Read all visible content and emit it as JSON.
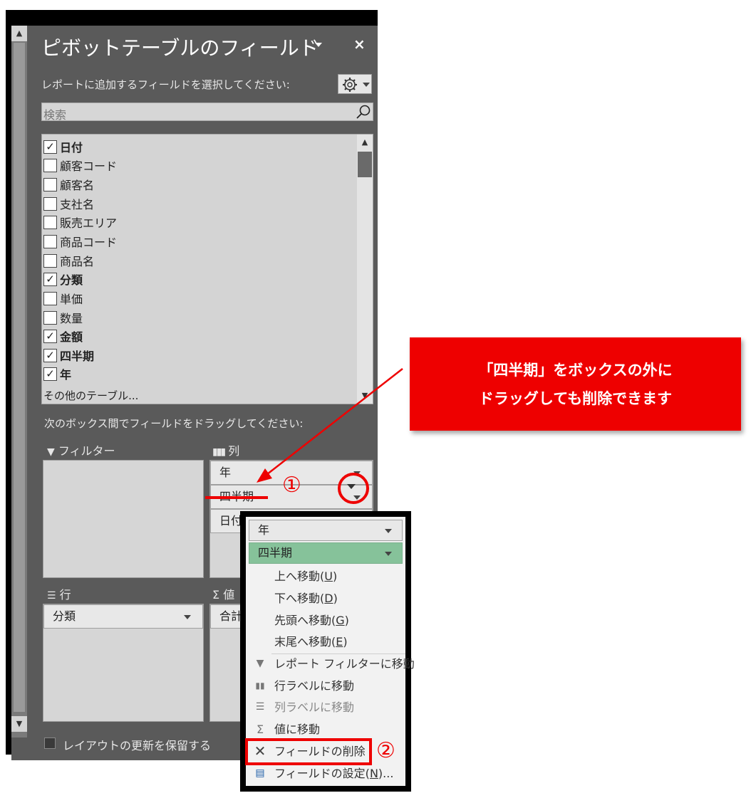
{
  "panel": {
    "title": "ピボットテーブルのフィールド",
    "title_dropdown_icon": "chevron-down-icon",
    "close_label": "×",
    "subtitle": "レポートに追加するフィールドを選択してください:",
    "settings_icon": "gear-icon",
    "search_placeholder": "検索",
    "fields": [
      {
        "label": "日付",
        "checked": true
      },
      {
        "label": "顧客コード",
        "checked": false
      },
      {
        "label": "顧客名",
        "checked": false
      },
      {
        "label": "支社名",
        "checked": false
      },
      {
        "label": "販売エリア",
        "checked": false
      },
      {
        "label": "商品コード",
        "checked": false
      },
      {
        "label": "商品名",
        "checked": false
      },
      {
        "label": "分類",
        "checked": true
      },
      {
        "label": "単価",
        "checked": false
      },
      {
        "label": "数量",
        "checked": false
      },
      {
        "label": "金額",
        "checked": true
      },
      {
        "label": "四半期",
        "checked": true
      },
      {
        "label": "年",
        "checked": true
      }
    ],
    "more_tables": "その他のテーブル...",
    "drag_hint": "次のボックス間でフィールドをドラッグしてください:",
    "areas": {
      "filter_label": "フィルター",
      "columns_label": "列",
      "rows_label": "行",
      "values_label": "値",
      "columns_items": [
        "年",
        "四半期",
        "日付"
      ],
      "rows_items": [
        "分類"
      ],
      "values_items": [
        "合計"
      ]
    },
    "defer_update": "レイアウトの更新を保留する"
  },
  "annotations": {
    "callout_line1": "「四半期」をボックスの外に",
    "callout_line2": "ドラッグしても削除できます",
    "marker1": "①",
    "marker2": "②",
    "accent_color": "#ee0000"
  },
  "menu": {
    "header_items": [
      "年",
      "四半期"
    ],
    "move_up": "上へ移動(",
    "move_up_key": "U",
    "move_down": "下へ移動(",
    "move_down_key": "D",
    "move_first": "先頭へ移動(",
    "move_first_key": "G",
    "move_last": "末尾へ移動(",
    "move_last_key": "E",
    "to_filter": "レポート フィルターに移動",
    "to_rows": "行ラベルに移動",
    "to_columns": "列ラベルに移動",
    "to_values": "値に移動",
    "remove_field": "フィールドの削除",
    "field_settings": "フィールドの設定(",
    "field_settings_key": "N",
    "field_settings_suffix": ")..."
  }
}
